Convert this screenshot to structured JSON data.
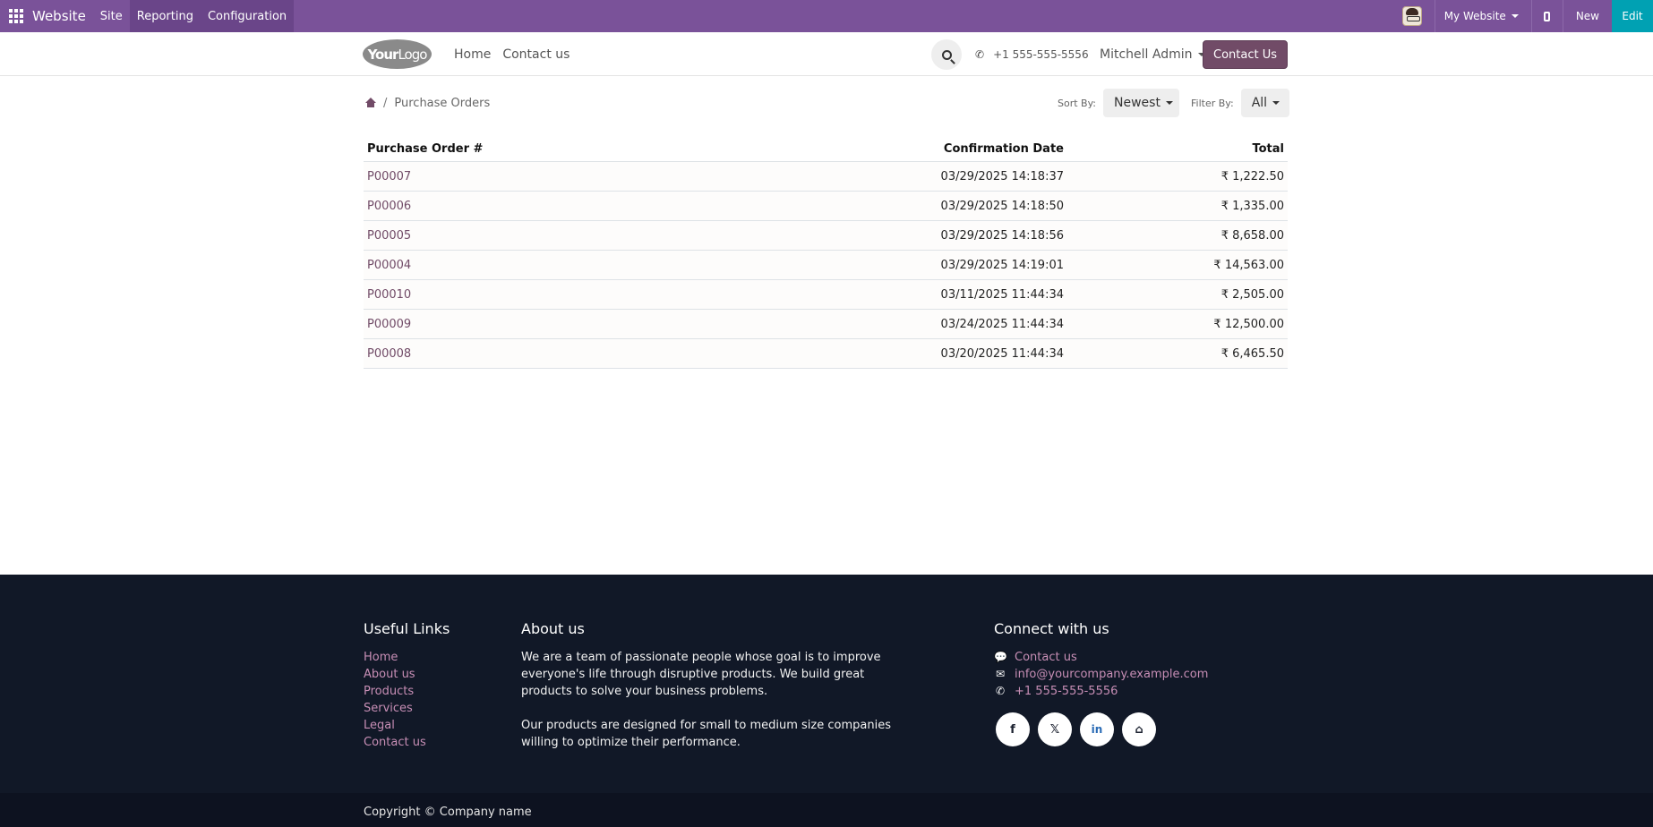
{
  "admin_bar": {
    "app_name": "Website",
    "menus": [
      "Site",
      "Reporting",
      "Configuration"
    ],
    "website_selector": "My Website",
    "new_label": "New",
    "edit_label": "Edit",
    "bg_color": "#7a5299"
  },
  "header": {
    "logo_bold": "Your",
    "logo_light": "Logo",
    "nav": [
      "Home",
      "Contact us"
    ],
    "phone": "+1 555-555-5556",
    "user": "Mitchell Admin",
    "cta": "Contact Us"
  },
  "breadcrumb": {
    "separator": "/",
    "current": "Purchase Orders"
  },
  "controls": {
    "sort_label": "Sort By:",
    "sort_value": "Newest",
    "filter_label": "Filter By:",
    "filter_value": "All"
  },
  "table": {
    "columns": [
      "Purchase Order #",
      "Confirmation Date",
      "Total"
    ],
    "rows": [
      {
        "ref": "P00007",
        "date": "03/29/2025  14:18:37",
        "total": "₹ 1,222.50"
      },
      {
        "ref": "P00006",
        "date": "03/29/2025  14:18:50",
        "total": "₹ 1,335.00"
      },
      {
        "ref": "P00005",
        "date": "03/29/2025  14:18:56",
        "total": "₹ 8,658.00"
      },
      {
        "ref": "P00004",
        "date": "03/29/2025  14:19:01",
        "total": "₹ 14,563.00"
      },
      {
        "ref": "P00010",
        "date": "03/11/2025  11:44:34",
        "total": "₹ 2,505.00"
      },
      {
        "ref": "P00009",
        "date": "03/24/2025  11:44:34",
        "total": "₹ 12,500.00"
      },
      {
        "ref": "P00008",
        "date": "03/20/2025  11:44:34",
        "total": "₹ 6,465.50"
      }
    ]
  },
  "footer": {
    "useful_links_title": "Useful Links",
    "useful_links": [
      "Home",
      "About us",
      "Products",
      "Services",
      "Legal",
      "Contact us"
    ],
    "about_title": "About us",
    "about_p1": "We are a team of passionate people whose goal is to improve everyone's life through disruptive products. We build great products to solve your business problems.",
    "about_p2": "Our products are designed for small to medium size companies willing to optimize their performance.",
    "connect_title": "Connect with us",
    "connect_contact": "Contact us",
    "connect_email": "info@yourcompany.example.com",
    "connect_phone": "+1 555-555-5556",
    "socials": [
      "facebook-icon",
      "x-icon",
      "linkedin-icon",
      "home-icon"
    ],
    "copyright": "Copyright © Company name"
  }
}
